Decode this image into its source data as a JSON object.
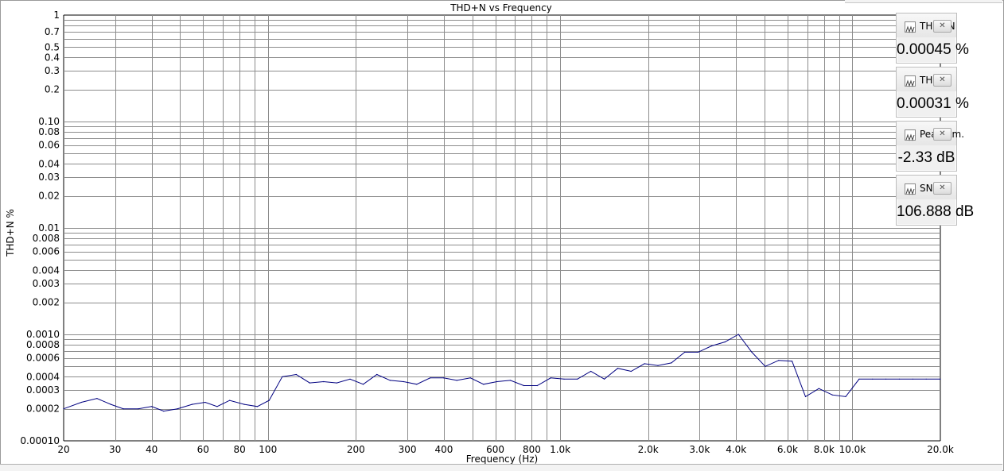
{
  "chart_data": {
    "type": "line",
    "title": "THD+N vs Frequency",
    "xlabel": "Frequency (Hz)",
    "ylabel": "THD+N %",
    "xscale": "log",
    "yscale": "log",
    "xlim": [
      20,
      20000
    ],
    "ylim": [
      0.0001,
      1
    ],
    "grid": true,
    "line_color": "#000080",
    "x_ticks": [
      {
        "v": 20,
        "label": "20"
      },
      {
        "v": 30,
        "label": "30"
      },
      {
        "v": 40,
        "label": "40"
      },
      {
        "v": 60,
        "label": "60"
      },
      {
        "v": 80,
        "label": "80"
      },
      {
        "v": 100,
        "label": "100"
      },
      {
        "v": 200,
        "label": "200"
      },
      {
        "v": 300,
        "label": "300"
      },
      {
        "v": 400,
        "label": "400"
      },
      {
        "v": 600,
        "label": "600"
      },
      {
        "v": 800,
        "label": "800"
      },
      {
        "v": 1000,
        "label": "1.0k"
      },
      {
        "v": 2000,
        "label": "2.0k"
      },
      {
        "v": 3000,
        "label": "3.0k"
      },
      {
        "v": 4000,
        "label": "4.0k"
      },
      {
        "v": 6000,
        "label": "6.0k"
      },
      {
        "v": 8000,
        "label": "8.0k"
      },
      {
        "v": 10000,
        "label": "10.0k"
      },
      {
        "v": 20000,
        "label": "20.0k"
      }
    ],
    "x_minor": [
      50,
      70,
      90,
      500,
      700,
      900,
      5000,
      7000,
      9000
    ],
    "y_ticks": [
      {
        "v": 1,
        "label": "1"
      },
      {
        "v": 0.7,
        "label": "0.7"
      },
      {
        "v": 0.5,
        "label": "0.5"
      },
      {
        "v": 0.4,
        "label": "0.4"
      },
      {
        "v": 0.3,
        "label": "0.3"
      },
      {
        "v": 0.2,
        "label": "0.2"
      },
      {
        "v": 0.1,
        "label": "0.10"
      },
      {
        "v": 0.08,
        "label": "0.08"
      },
      {
        "v": 0.06,
        "label": "0.06"
      },
      {
        "v": 0.04,
        "label": "0.04"
      },
      {
        "v": 0.03,
        "label": "0.03"
      },
      {
        "v": 0.02,
        "label": "0.02"
      },
      {
        "v": 0.01,
        "label": "0.01"
      },
      {
        "v": 0.008,
        "label": "0.008"
      },
      {
        "v": 0.006,
        "label": "0.006"
      },
      {
        "v": 0.004,
        "label": "0.004"
      },
      {
        "v": 0.003,
        "label": "0.003"
      },
      {
        "v": 0.002,
        "label": "0.002"
      },
      {
        "v": 0.001,
        "label": "0.0010"
      },
      {
        "v": 0.0008,
        "label": "0.0008"
      },
      {
        "v": 0.0006,
        "label": "0.0006"
      },
      {
        "v": 0.0004,
        "label": "0.0004"
      },
      {
        "v": 0.0003,
        "label": "0.0003"
      },
      {
        "v": 0.0002,
        "label": "0.0002"
      },
      {
        "v": 0.0001,
        "label": "0.00010"
      }
    ],
    "y_minor": [
      0.9,
      0.8,
      0.6,
      0.09,
      0.07,
      0.05,
      0.009,
      0.007,
      0.005,
      0.0009,
      0.0007,
      0.0005
    ],
    "series": [
      {
        "x": [
          20,
          23,
          26,
          29,
          32,
          36,
          40,
          44,
          49,
          55,
          61,
          67,
          74,
          83,
          92,
          101,
          112,
          125,
          139,
          155,
          172,
          191,
          212,
          236,
          262,
          291,
          323,
          359,
          399,
          443,
          493,
          547,
          608,
          676,
          751,
          835,
          928,
          1031,
          1146,
          1274,
          1416,
          1574,
          1749,
          1944,
          2161,
          2402,
          2669,
          2967,
          3298,
          3665,
          4074,
          4528,
          5033,
          5594,
          6217,
          6910,
          7680,
          8536,
          9488,
          10545,
          11720,
          13027,
          14479,
          16093,
          17886,
          20000
        ],
        "y": [
          0.0002,
          0.00023,
          0.00025,
          0.00022,
          0.0002,
          0.0002,
          0.00021,
          0.00019,
          0.0002,
          0.00022,
          0.00023,
          0.00021,
          0.00024,
          0.00022,
          0.00021,
          0.00024,
          0.0004,
          0.00042,
          0.00035,
          0.00036,
          0.00035,
          0.00038,
          0.00034,
          0.00042,
          0.00037,
          0.00036,
          0.00034,
          0.00039,
          0.00039,
          0.00037,
          0.00039,
          0.00034,
          0.00036,
          0.00037,
          0.00033,
          0.00033,
          0.00039,
          0.00038,
          0.00038,
          0.00045,
          0.00038,
          0.00048,
          0.00045,
          0.00053,
          0.00051,
          0.00054,
          0.00068,
          0.00068,
          0.00078,
          0.00085,
          0.001,
          0.00068,
          0.0005,
          0.00057,
          0.00056,
          0.00026,
          0.00031,
          0.00027,
          0.00026,
          0.00038,
          0.00038,
          0.00038,
          0.00038,
          0.00038,
          0.00038,
          0.00038
        ]
      }
    ]
  },
  "meters": [
    {
      "title": "THD+N",
      "value": "0.00045 %",
      "icon": "waveform-icon"
    },
    {
      "title": "THD",
      "value": "0.00031 %",
      "icon": "waveform-icon"
    },
    {
      "title": "Peak Am...",
      "value": "-2.33 dB",
      "icon": "waveform-icon"
    },
    {
      "title": "SNR",
      "value": "106.888 dB",
      "icon": "waveform-icon"
    }
  ],
  "close_glyph": "✕"
}
